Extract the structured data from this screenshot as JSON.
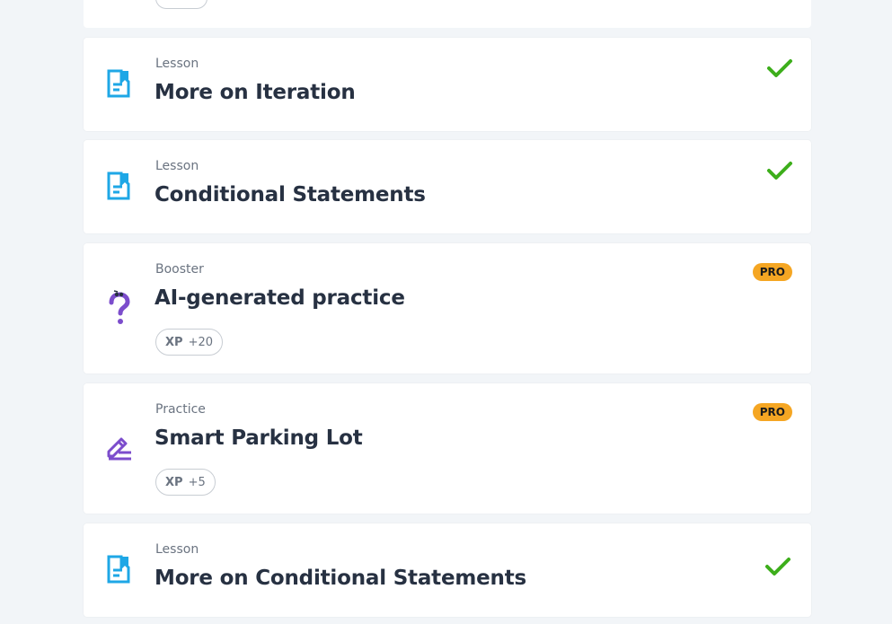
{
  "items": [
    {
      "type": "Lesson",
      "title": "More on Iteration",
      "status": "completed",
      "icon": "lesson-doc-icon"
    },
    {
      "type": "Lesson",
      "title": "Conditional Statements",
      "status": "completed",
      "icon": "lesson-doc-icon"
    },
    {
      "type": "Booster",
      "title": "AI-generated practice",
      "badge": "PRO",
      "xp_label": "XP",
      "xp_value": "+20",
      "icon": "question-mark-icon"
    },
    {
      "type": "Practice",
      "title": "Smart Parking Lot",
      "badge": "PRO",
      "xp_label": "XP",
      "xp_value": "+5",
      "icon": "pencil-edit-icon"
    },
    {
      "type": "Lesson",
      "title": "More on Conditional Statements",
      "status": "completed",
      "icon": "lesson-doc-icon"
    }
  ],
  "colors": {
    "background": "#f2f5f8",
    "lesson_icon": "#1ea7e6",
    "check": "#3dae1b",
    "pro_badge": "#f5a623",
    "booster_icon": "#7c4dcc",
    "title": "#273142"
  }
}
